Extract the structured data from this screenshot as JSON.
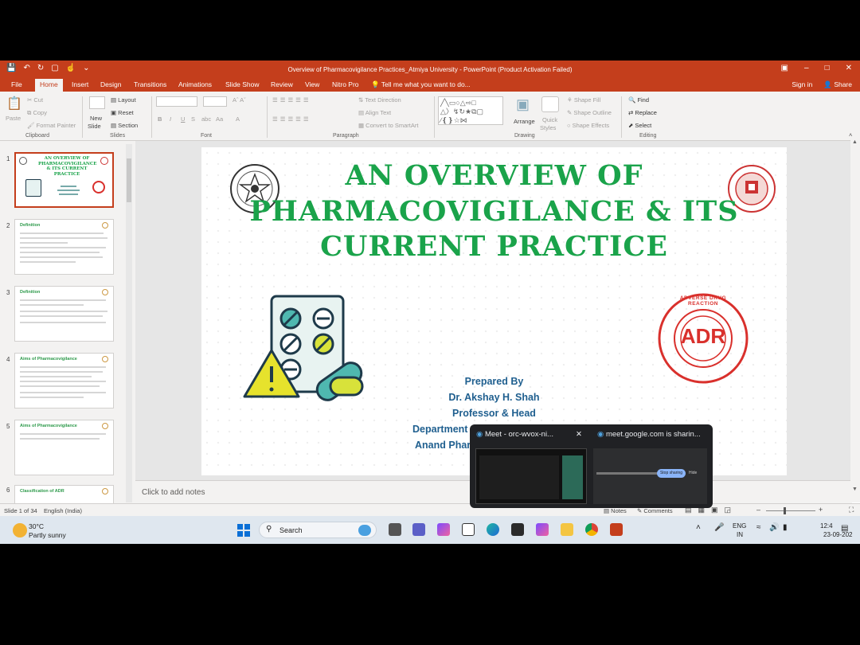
{
  "window": {
    "title": "Overview of Pharmacovigilance Practices_Atmiya University - PowerPoint (Product Activation Failed)",
    "sign_in": "Sign in",
    "share": "Share"
  },
  "menu": {
    "tabs": [
      "File",
      "Home",
      "Insert",
      "Design",
      "Transitions",
      "Animations",
      "Slide Show",
      "Review",
      "View",
      "Nitro Pro"
    ],
    "active": "Home",
    "tell_me": "Tell me what you want to do..."
  },
  "ribbon": {
    "clipboard": {
      "label": "Clipboard",
      "paste": "Paste",
      "cut": "Cut",
      "copy": "Copy",
      "format_painter": "Format Painter"
    },
    "slides": {
      "label": "Slides",
      "new_slide": "New",
      "new_slide2": "Slide",
      "layout": "Layout",
      "reset": "Reset",
      "section": "Section"
    },
    "font": {
      "label": "Font",
      "bold": "B",
      "italic": "I",
      "underline": "U",
      "strike": "S",
      "abc": "abc",
      "aa": "Aa",
      "a": "A"
    },
    "paragraph": {
      "label": "Paragraph",
      "text_direction": "Text Direction",
      "align_text": "Align Text",
      "convert": "Convert to SmartArt"
    },
    "drawing": {
      "label": "Drawing",
      "arrange": "Arrange",
      "quick": "Quick",
      "styles": "Styles",
      "shape_fill": "Shape Fill",
      "shape_outline": "Shape Outline",
      "shape_effects": "Shape Effects"
    },
    "editing": {
      "label": "Editing",
      "find": "Find",
      "replace": "Replace",
      "select": "Select"
    }
  },
  "thumbnails": [
    {
      "num": "1",
      "title": "AN OVERVIEW OF PHARMACOVIGILANCE & ITS CURRENT PRACTICE"
    },
    {
      "num": "2",
      "title": "Definition"
    },
    {
      "num": "3",
      "title": "Definition"
    },
    {
      "num": "4",
      "title": "Aims of Pharmacovigilance"
    },
    {
      "num": "5",
      "title": "Aims of Pharmacovigilance"
    },
    {
      "num": "6",
      "title": "Classification of ADR"
    }
  ],
  "slide": {
    "title_lines": [
      "AN OVERVIEW OF",
      "PHARMACOVIGILANCE & ITS",
      "CURRENT PRACTICE"
    ],
    "prepared_by": "Prepared By",
    "author": "Dr. Akshay H. Shah",
    "position": "Professor & Head",
    "department": "Department",
    "college": "Anand Phar",
    "stamp_text": "ADR",
    "stamp_ring": "ADVERSE DRUG REACTION"
  },
  "notes_placeholder": "Click to add notes",
  "status": {
    "slide_of": "Slide 1 of 34",
    "language": "English (India)",
    "notes": "Notes",
    "comments": "Comments"
  },
  "taskbar": {
    "temp": "30°C",
    "weather": "Partly sunny",
    "search": "Search",
    "lang1": "ENG",
    "lang2": "IN",
    "time": "12:4",
    "date": "23-09-202"
  },
  "meet": {
    "tab1": "Meet - orc-wvox-ni...",
    "tab2": "meet.google.com is sharin...",
    "stop": "Stop sharing",
    "hide": "Hide"
  },
  "colors": {
    "accent": "#c43e1c",
    "title_green": "#1aa34a",
    "text_blue": "#1f5f8f",
    "stamp_red": "#d9302c"
  }
}
